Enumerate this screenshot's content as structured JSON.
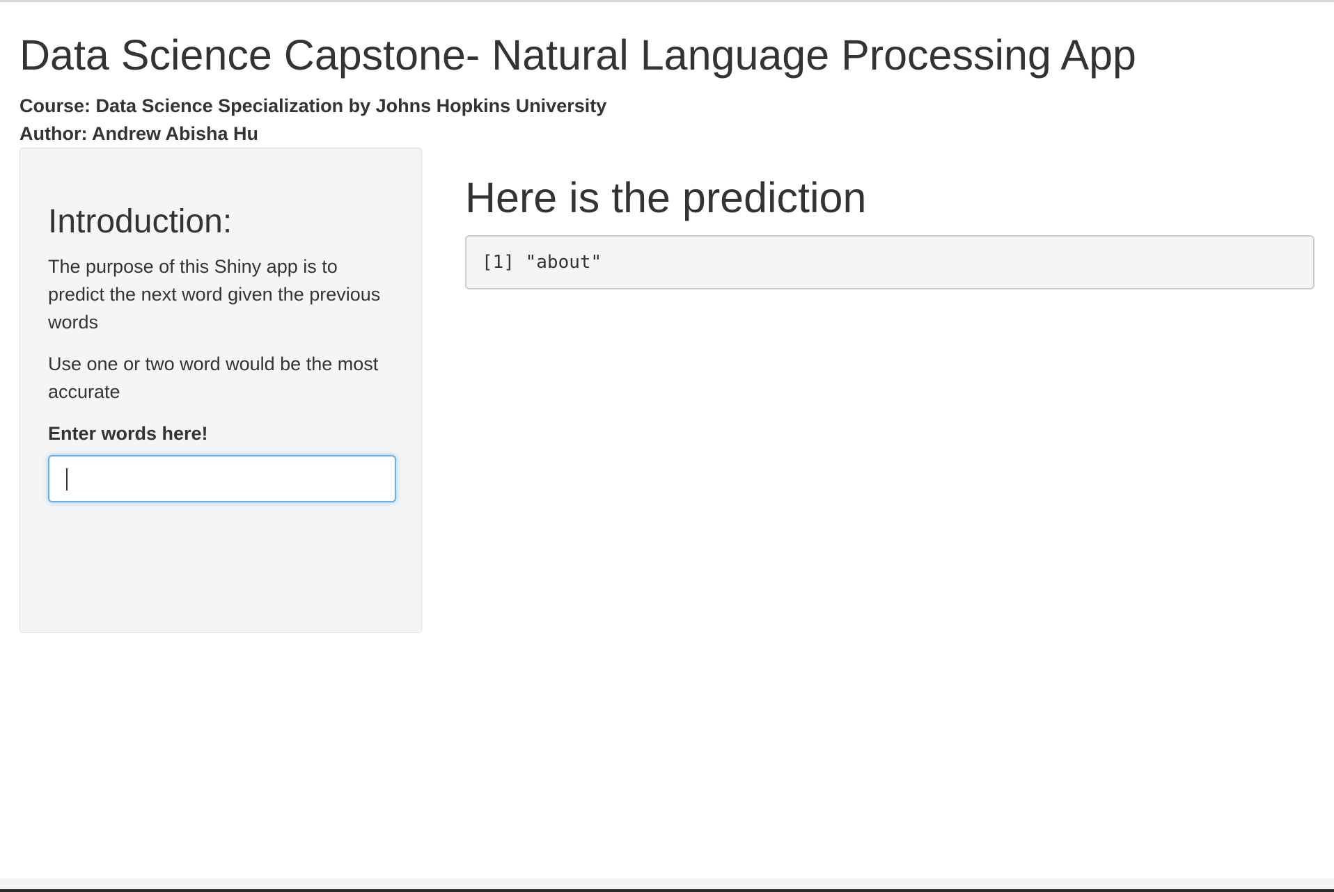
{
  "header": {
    "title": "Data Science Capstone- Natural Language Processing App",
    "course": "Course: Data Science Specialization by Johns Hopkins University",
    "author": "Author: Andrew Abisha Hu"
  },
  "sidebar": {
    "heading": "Introduction:",
    "paragraph1": "The purpose of this Shiny app is to predict the next word given the previous words",
    "paragraph2": "Use one or two word would be the most accurate",
    "input_label": "Enter words here!",
    "input_value": ""
  },
  "main": {
    "heading": "Here is the prediction",
    "output": "[1] \"about\""
  },
  "colors": {
    "panel_background": "#f5f5f5",
    "input_focus_border": "#66afe9",
    "text": "#333333"
  }
}
